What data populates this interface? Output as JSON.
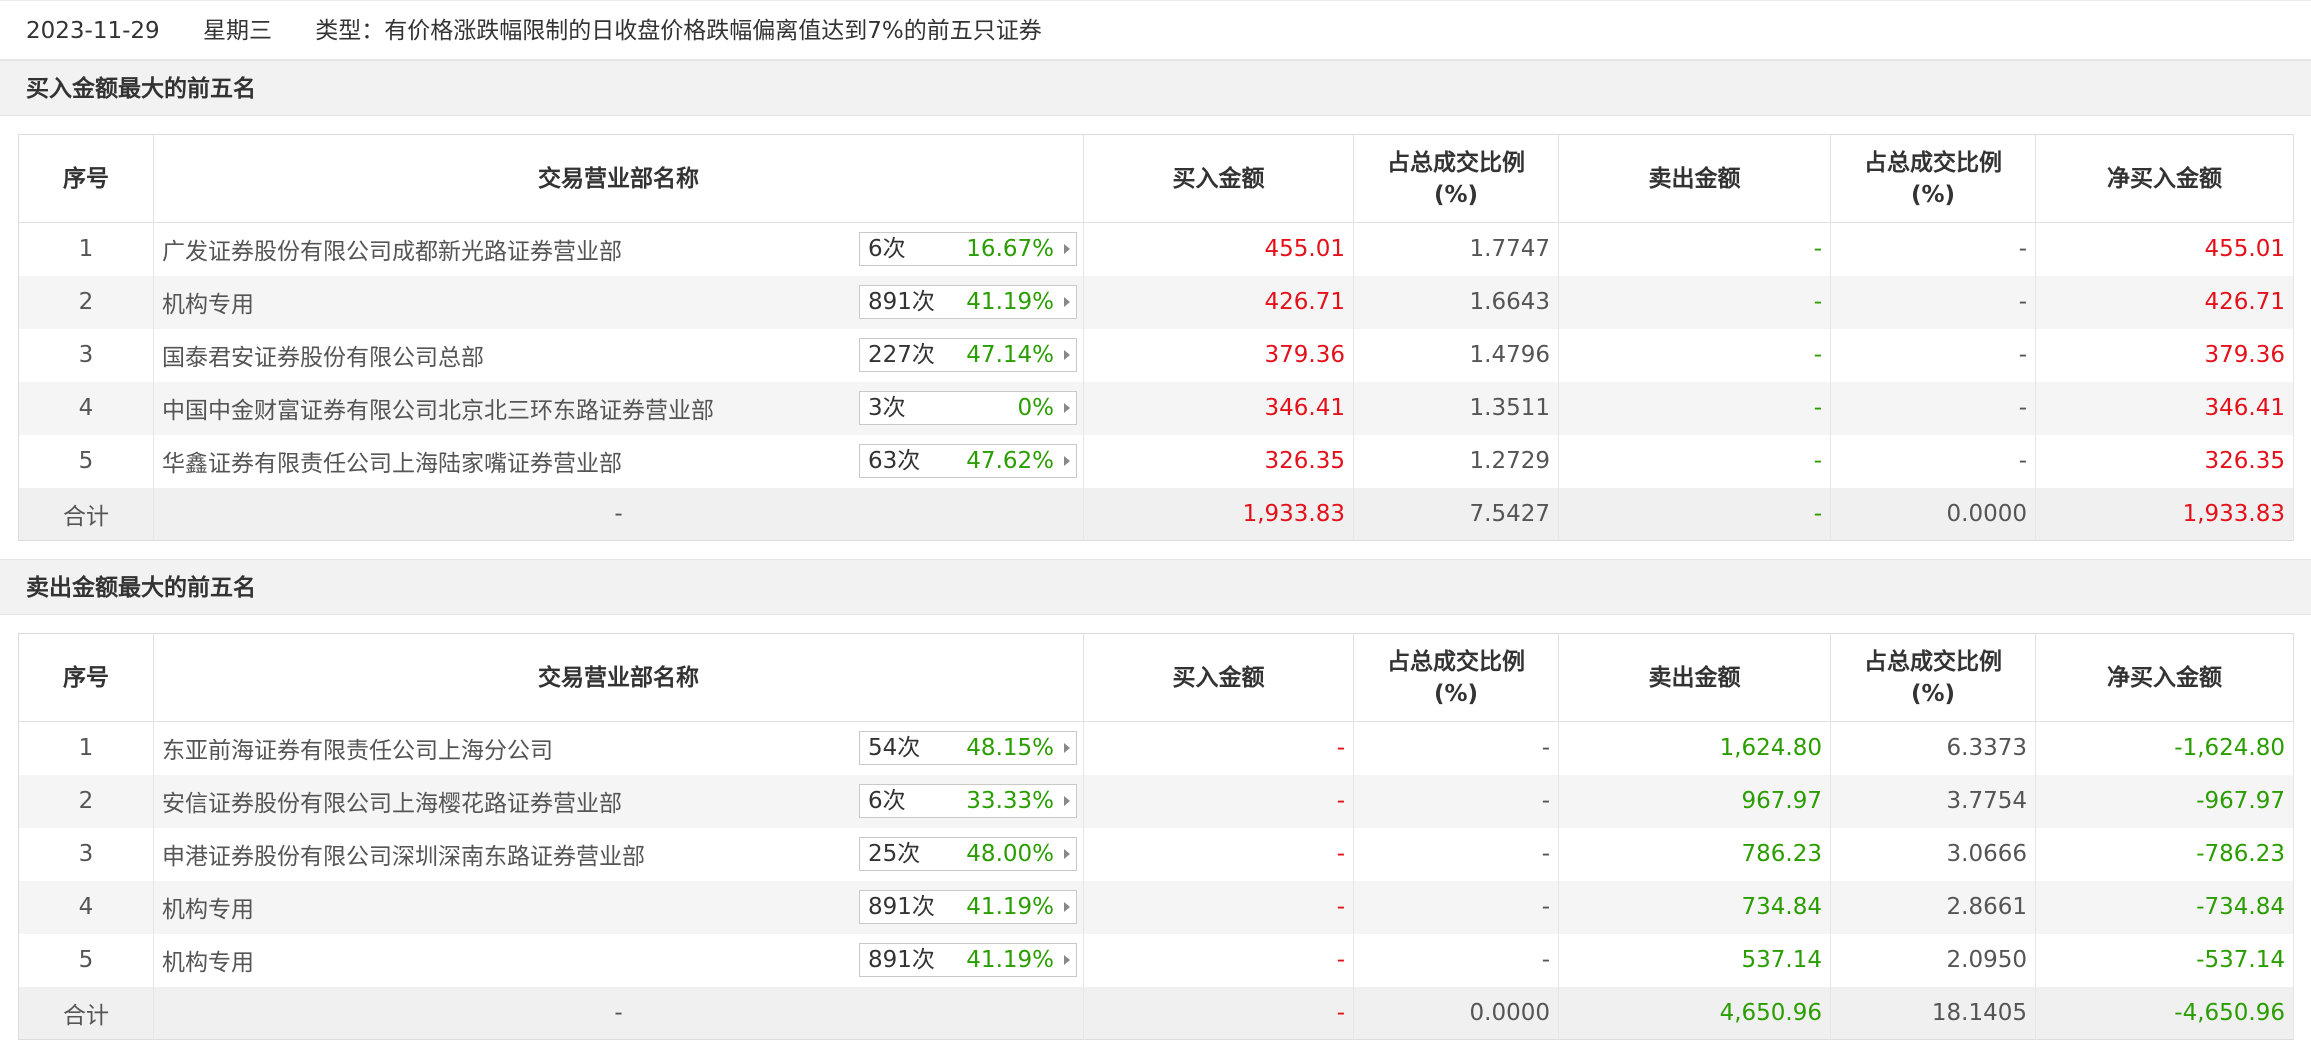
{
  "header": {
    "date": "2023-11-29",
    "weekday": "星期三",
    "type_label": "类型：有价格涨跌幅限制的日收盘价格跌幅偏离值达到7%的前五只证券"
  },
  "columns": {
    "rank": "序号",
    "dept": "交易营业部名称",
    "buy": "买入金额",
    "buy_ratio": "占总成交比例(%)",
    "sell": "卖出金额",
    "sell_ratio": "占总成交比例(%)",
    "net": "净买入金额"
  },
  "buy_section": {
    "title": "买入金额最大的前五名",
    "rows": [
      {
        "rank": "1",
        "name": "广发证券股份有限公司成都新光路证券营业部",
        "count": "6次",
        "pct": "16.67%",
        "buy": "455.01",
        "buy_ratio": "1.7747",
        "sell": "-",
        "sell_ratio": "-",
        "net": "455.01"
      },
      {
        "rank": "2",
        "name": "机构专用",
        "count": "891次",
        "pct": "41.19%",
        "buy": "426.71",
        "buy_ratio": "1.6643",
        "sell": "-",
        "sell_ratio": "-",
        "net": "426.71"
      },
      {
        "rank": "3",
        "name": "国泰君安证券股份有限公司总部",
        "count": "227次",
        "pct": "47.14%",
        "buy": "379.36",
        "buy_ratio": "1.4796",
        "sell": "-",
        "sell_ratio": "-",
        "net": "379.36"
      },
      {
        "rank": "4",
        "name": "中国中金财富证券有限公司北京北三环东路证券营业部",
        "count": "3次",
        "pct": "0%",
        "buy": "346.41",
        "buy_ratio": "1.3511",
        "sell": "-",
        "sell_ratio": "-",
        "net": "346.41"
      },
      {
        "rank": "5",
        "name": "华鑫证券有限责任公司上海陆家嘴证券营业部",
        "count": "63次",
        "pct": "47.62%",
        "buy": "326.35",
        "buy_ratio": "1.2729",
        "sell": "-",
        "sell_ratio": "-",
        "net": "326.35"
      }
    ],
    "total": {
      "label": "合计",
      "name": "-",
      "buy": "1,933.83",
      "buy_ratio": "7.5427",
      "sell": "-",
      "sell_ratio": "0.0000",
      "net": "1,933.83"
    }
  },
  "sell_section": {
    "title": "卖出金额最大的前五名",
    "rows": [
      {
        "rank": "1",
        "name": "东亚前海证券有限责任公司上海分公司",
        "count": "54次",
        "pct": "48.15%",
        "buy": "-",
        "buy_ratio": "-",
        "sell": "1,624.80",
        "sell_ratio": "6.3373",
        "net": "-1,624.80"
      },
      {
        "rank": "2",
        "name": "安信证券股份有限公司上海樱花路证券营业部",
        "count": "6次",
        "pct": "33.33%",
        "buy": "-",
        "buy_ratio": "-",
        "sell": "967.97",
        "sell_ratio": "3.7754",
        "net": "-967.97"
      },
      {
        "rank": "3",
        "name": "申港证券股份有限公司深圳深南东路证券营业部",
        "count": "25次",
        "pct": "48.00%",
        "buy": "-",
        "buy_ratio": "-",
        "sell": "786.23",
        "sell_ratio": "3.0666",
        "net": "-786.23"
      },
      {
        "rank": "4",
        "name": "机构专用",
        "count": "891次",
        "pct": "41.19%",
        "buy": "-",
        "buy_ratio": "-",
        "sell": "734.84",
        "sell_ratio": "2.8661",
        "net": "-734.84"
      },
      {
        "rank": "5",
        "name": "机构专用",
        "count": "891次",
        "pct": "41.19%",
        "buy": "-",
        "buy_ratio": "-",
        "sell": "537.14",
        "sell_ratio": "2.0950",
        "net": "-537.14"
      }
    ],
    "total": {
      "label": "合计",
      "name": "-",
      "buy": "-",
      "buy_ratio": "0.0000",
      "sell": "4,650.96",
      "sell_ratio": "18.1405",
      "net": "-4,650.96"
    }
  },
  "colors": {
    "positive": "#e4101a",
    "negative": "#2a9d00",
    "header_bg": "#f2f2f2"
  },
  "icons": {
    "badge_arrow": "caret-right-icon"
  }
}
